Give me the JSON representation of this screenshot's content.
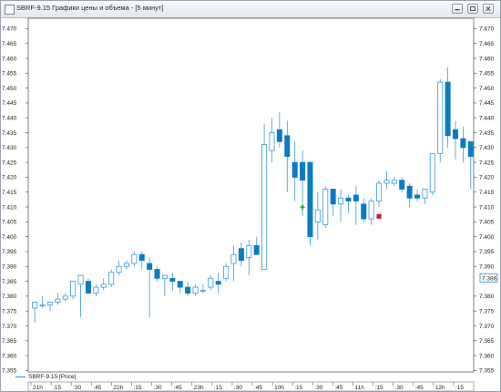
{
  "window": {
    "title": "SBRF-9.15 Графики цены и объема - [5 минут]"
  },
  "legend": {
    "label": "SBRF-9.15 [Price]"
  },
  "colors": {
    "up_candle": "#ffffff",
    "down_candle": "#0b7cc1",
    "wick": "#3a9ad8",
    "marker_buy": "#22c022",
    "marker_sell": "#c11a3a",
    "current_price_box": "#2e8fd1"
  },
  "price_label": "7.386",
  "chart_data": {
    "type": "candlestick",
    "timeframe": "5 минут",
    "ylim": [
      7.3545,
      7.4735
    ],
    "y_ticks": [
      "7.470",
      "7.465",
      "7.460",
      "7.455",
      "7.450",
      "7.445",
      "7.440",
      "7.435",
      "7.430",
      "7.425",
      "7.420",
      "7.415",
      "7.410",
      "7.405",
      "7.400",
      "7.395",
      "7.390",
      "7.385",
      "7.380",
      "7.375",
      "7.370",
      "7.365",
      "7.360",
      "7.355"
    ],
    "right_ticks": [
      "7.470",
      "7.465",
      "7.460",
      "7.455",
      "7.450",
      "7.445",
      "7.440",
      "7.435",
      "7.430",
      "7.425",
      "7.420",
      "7.415",
      "7.410",
      "7.405",
      "7.400",
      "7.395",
      "7.390",
      "7.380",
      "7.375",
      "7.370",
      "7.365",
      "7.360",
      "7.355"
    ],
    "x_ticks": [
      "21h",
      ":15",
      ":30",
      ":45",
      "22h",
      ":15",
      ":30",
      ":45",
      "23h",
      ":15",
      ":30",
      ":45",
      "10h",
      ":15",
      ":30",
      ":45",
      "11h",
      ":15",
      ":30",
      ":45",
      "12h",
      ":15"
    ],
    "candles": [
      {
        "o": 7.376,
        "h": 7.378,
        "l": 7.371,
        "c": 7.378
      },
      {
        "o": 7.377,
        "h": 7.38,
        "l": 7.376,
        "c": 7.377
      },
      {
        "o": 7.377,
        "h": 7.378,
        "l": 7.375,
        "c": 7.378
      },
      {
        "o": 7.378,
        "h": 7.381,
        "l": 7.377,
        "c": 7.379
      },
      {
        "o": 7.379,
        "h": 7.381,
        "l": 7.378,
        "c": 7.38
      },
      {
        "o": 7.38,
        "h": 7.385,
        "l": 7.379,
        "c": 7.385
      },
      {
        "o": 7.384,
        "h": 7.387,
        "l": 7.373,
        "c": 7.387
      },
      {
        "o": 7.385,
        "h": 7.386,
        "l": 7.382,
        "c": 7.381
      },
      {
        "o": 7.381,
        "h": 7.384,
        "l": 7.38,
        "c": 7.383
      },
      {
        "o": 7.383,
        "h": 7.386,
        "l": 7.382,
        "c": 7.384
      },
      {
        "o": 7.384,
        "h": 7.389,
        "l": 7.383,
        "c": 7.388
      },
      {
        "o": 7.388,
        "h": 7.392,
        "l": 7.387,
        "c": 7.39
      },
      {
        "o": 7.39,
        "h": 7.392,
        "l": 7.389,
        "c": 7.391
      },
      {
        "o": 7.391,
        "h": 7.395,
        "l": 7.39,
        "c": 7.394
      },
      {
        "o": 7.394,
        "h": 7.395,
        "l": 7.389,
        "c": 7.392
      },
      {
        "o": 7.391,
        "h": 7.393,
        "l": 7.373,
        "c": 7.389
      },
      {
        "o": 7.389,
        "h": 7.39,
        "l": 7.385,
        "c": 7.386
      },
      {
        "o": 7.386,
        "h": 7.387,
        "l": 7.38,
        "c": 7.387
      },
      {
        "o": 7.386,
        "h": 7.388,
        "l": 7.382,
        "c": 7.385
      },
      {
        "o": 7.385,
        "h": 7.385,
        "l": 7.381,
        "c": 7.383
      },
      {
        "o": 7.383,
        "h": 7.385,
        "l": 7.38,
        "c": 7.381
      },
      {
        "o": 7.381,
        "h": 7.384,
        "l": 7.38,
        "c": 7.383
      },
      {
        "o": 7.382,
        "h": 7.384,
        "l": 7.381,
        "c": 7.382
      },
      {
        "o": 7.383,
        "h": 7.387,
        "l": 7.382,
        "c": 7.386
      },
      {
        "o": 7.385,
        "h": 7.388,
        "l": 7.381,
        "c": 7.384
      },
      {
        "o": 7.386,
        "h": 7.391,
        "l": 7.385,
        "c": 7.39
      },
      {
        "o": 7.391,
        "h": 7.397,
        "l": 7.385,
        "c": 7.394
      },
      {
        "o": 7.396,
        "h": 7.398,
        "l": 7.39,
        "c": 7.392
      },
      {
        "o": 7.393,
        "h": 7.399,
        "l": 7.387,
        "c": 7.397
      },
      {
        "o": 7.397,
        "h": 7.4,
        "l": 7.394,
        "c": 7.394
      },
      {
        "o": 7.389,
        "h": 7.438,
        "l": 7.389,
        "c": 7.431
      },
      {
        "o": 7.429,
        "h": 7.44,
        "l": 7.425,
        "c": 7.435
      },
      {
        "o": 7.436,
        "h": 7.442,
        "l": 7.43,
        "c": 7.432
      },
      {
        "o": 7.434,
        "h": 7.439,
        "l": 7.415,
        "c": 7.427
      },
      {
        "o": 7.425,
        "h": 7.432,
        "l": 7.412,
        "c": 7.42
      },
      {
        "o": 7.425,
        "h": 7.429,
        "l": 7.407,
        "c": 7.419
      },
      {
        "o": 7.425,
        "h": 7.425,
        "l": 7.397,
        "c": 7.4
      },
      {
        "o": 7.405,
        "h": 7.415,
        "l": 7.399,
        "c": 7.409
      },
      {
        "o": 7.404,
        "h": 7.417,
        "l": 7.403,
        "c": 7.416
      },
      {
        "o": 7.416,
        "h": 7.416,
        "l": 7.407,
        "c": 7.411
      },
      {
        "o": 7.411,
        "h": 7.416,
        "l": 7.405,
        "c": 7.413
      },
      {
        "o": 7.413,
        "h": 7.414,
        "l": 7.408,
        "c": 7.412
      },
      {
        "o": 7.414,
        "h": 7.417,
        "l": 7.404,
        "c": 7.412
      },
      {
        "o": 7.411,
        "h": 7.413,
        "l": 7.405,
        "c": 7.406
      },
      {
        "o": 7.406,
        "h": 7.413,
        "l": 7.404,
        "c": 7.412
      },
      {
        "o": 7.412,
        "h": 7.419,
        "l": 7.41,
        "c": 7.418
      },
      {
        "o": 7.418,
        "h": 7.422,
        "l": 7.416,
        "c": 7.419
      },
      {
        "o": 7.418,
        "h": 7.42,
        "l": 7.417,
        "c": 7.419
      },
      {
        "o": 7.419,
        "h": 7.42,
        "l": 7.415,
        "c": 7.416
      },
      {
        "o": 7.417,
        "h": 7.418,
        "l": 7.41,
        "c": 7.413
      },
      {
        "o": 7.414,
        "h": 7.416,
        "l": 7.412,
        "c": 7.413
      },
      {
        "o": 7.413,
        "h": 7.415,
        "l": 7.411,
        "c": 7.416
      },
      {
        "o": 7.415,
        "h": 7.428,
        "l": 7.414,
        "c": 7.428
      },
      {
        "o": 7.428,
        "h": 7.453,
        "l": 7.425,
        "c": 7.452
      },
      {
        "o": 7.452,
        "h": 7.457,
        "l": 7.43,
        "c": 7.434
      },
      {
        "o": 7.436,
        "h": 7.439,
        "l": 7.426,
        "c": 7.433
      },
      {
        "o": 7.433,
        "h": 7.437,
        "l": 7.425,
        "c": 7.43
      },
      {
        "o": 7.432,
        "h": 7.432,
        "l": 7.416,
        "c": 7.427
      }
    ],
    "markers": [
      {
        "type": "buy",
        "index": 35,
        "price": 7.41
      },
      {
        "type": "sell",
        "index": 45,
        "price": 7.407
      }
    ],
    "current_price": 7.386
  }
}
